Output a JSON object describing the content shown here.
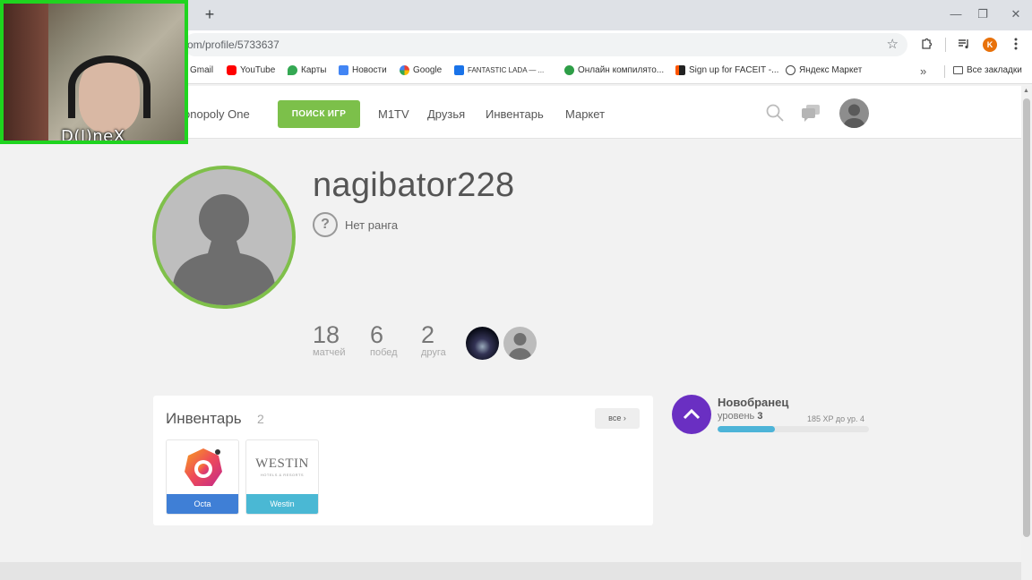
{
  "browser": {
    "url": "om/profile/5733637",
    "new_tab_label": "+",
    "window_controls": {
      "minimize": "—",
      "maximize": "❐",
      "close": "✕"
    },
    "star_icon": "☆",
    "profile_initial": "K",
    "bookmarks_more": "»",
    "bookmarks": [
      {
        "label": "Gmail",
        "icon": "gmail-icon",
        "color": "#ea4335"
      },
      {
        "label": "YouTube",
        "icon": "youtube-icon",
        "color": "#ff0000"
      },
      {
        "label": "Карты",
        "icon": "maps-icon",
        "color": "#34a853"
      },
      {
        "label": "Новости",
        "icon": "news-icon",
        "color": "#4285f4"
      },
      {
        "label": "Google",
        "icon": "google-icon",
        "color": "#4285f4"
      },
      {
        "label": "FANTASTIC LADA — ...",
        "icon": "fantastic-icon",
        "color": "#1a73e8"
      },
      {
        "label": "Онлайн компилято...",
        "icon": "compiler-icon",
        "color": "#2e9e47"
      },
      {
        "label": "Sign up for FACEIT -...",
        "icon": "faceit-icon",
        "color": "#ff5500"
      },
      {
        "label": "Яндекс Маркет",
        "icon": "yandex-market-icon",
        "color": "#444444"
      }
    ],
    "all_bookmarks": "Все закладки"
  },
  "webcam": {
    "name": "D(I)neX"
  },
  "site": {
    "brand": "onopoly One",
    "find_game_button": "ПОИСК ИГР",
    "nav": [
      "M1TV",
      "Друзья",
      "Инвентарь",
      "Маркет"
    ]
  },
  "profile": {
    "username": "nagibator228",
    "rank_icon": "?",
    "rank": "Нет ранга",
    "stats": [
      {
        "value": "18",
        "label": "матчей"
      },
      {
        "value": "6",
        "label": "побед"
      },
      {
        "value": "2",
        "label": "друга"
      }
    ]
  },
  "inventory": {
    "title": "Инвентарь",
    "count": "2",
    "all_button": "все",
    "all_chevron": "›",
    "items": [
      {
        "name": "Octa",
        "color": "#3f7fd6"
      },
      {
        "name": "Westin",
        "logo": "WESTIN",
        "logo_sub": "HOTELS & RESORTS",
        "color": "#4ab8d4"
      }
    ]
  },
  "level": {
    "title": "Новобранец",
    "level_label": "уровень",
    "level_value": "3",
    "xp_text": "185 XP до ур. 4",
    "progress": 0.38,
    "colors": {
      "badge": "#6a2fc2",
      "bar": "#4db4d8"
    }
  },
  "colors": {
    "accent_green": "#7cc04a",
    "webcam_border": "#1fd41f"
  }
}
